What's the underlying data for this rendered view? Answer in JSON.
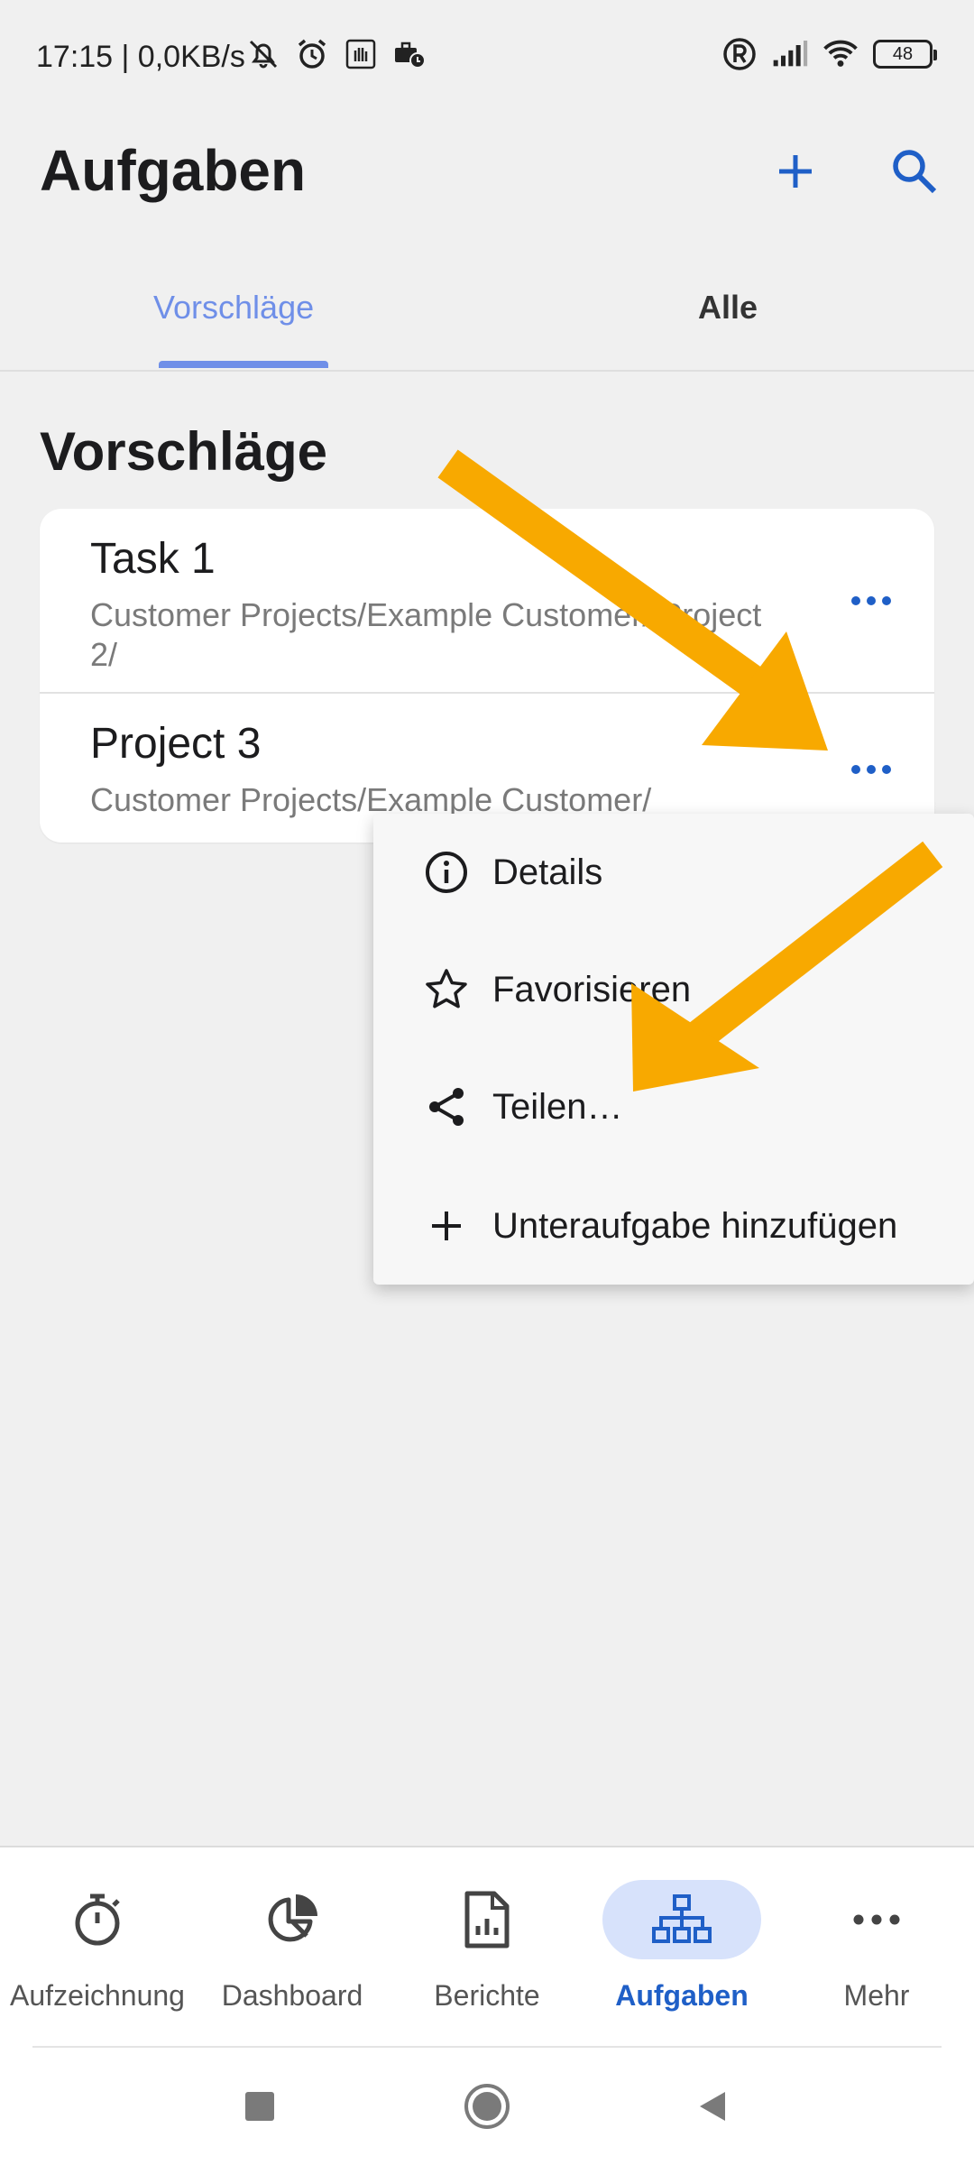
{
  "status_bar": {
    "time": "17:15 | 0,0KB/s",
    "battery": "48",
    "icons": [
      "mute-icon",
      "alarm-icon",
      "hand-icon",
      "briefcase-clock-icon",
      "registered-icon",
      "signal-icon",
      "wifi-icon",
      "battery-icon"
    ]
  },
  "header": {
    "title": "Aufgaben",
    "add_icon": "plus-icon",
    "search_icon": "search-icon",
    "accent_color": "#1f5fc7"
  },
  "tabs": [
    {
      "label": "Vorschläge",
      "active": true
    },
    {
      "label": "Alle",
      "active": false
    }
  ],
  "section_title": "Vorschläge",
  "list": [
    {
      "title": "Task 1",
      "path": "Customer Projects/Example Customer/ Project 2/"
    },
    {
      "title": "Project 3",
      "path": "Customer Projects/Example Customer/"
    }
  ],
  "menu": {
    "items": [
      {
        "label": "Details",
        "icon": "info-icon"
      },
      {
        "label": "Favorisieren",
        "icon": "star-icon"
      },
      {
        "label": "Teilen…",
        "icon": "share-icon"
      },
      {
        "label": "Unteraufgabe hinzufügen",
        "icon": "plus-icon"
      }
    ]
  },
  "annotation_color": "#f8a900",
  "bottom_nav": [
    {
      "label": "Aufzeichnung",
      "icon": "stopwatch-icon",
      "active": false
    },
    {
      "label": "Dashboard",
      "icon": "pie-chart-icon",
      "active": false
    },
    {
      "label": "Berichte",
      "icon": "report-icon",
      "active": false
    },
    {
      "label": "Aufgaben",
      "icon": "hierarchy-icon",
      "active": true
    },
    {
      "label": "Mehr",
      "icon": "more-icon",
      "active": false
    }
  ],
  "system_nav": [
    "recents-button",
    "home-button",
    "back-button"
  ]
}
